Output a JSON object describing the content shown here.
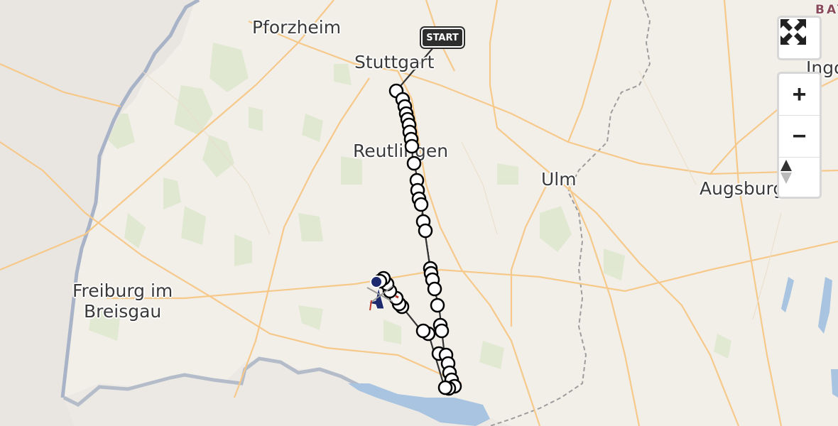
{
  "map": {
    "cities": [
      {
        "id": "pforzheim",
        "label": "Pforzheim"
      },
      {
        "id": "stuttgart",
        "label": "Stuttgart"
      },
      {
        "id": "reutlingen",
        "label": "Reutlingen"
      },
      {
        "id": "ulm",
        "label": "Ulm"
      },
      {
        "id": "augsburg",
        "label": "Augsburg"
      },
      {
        "id": "freiburg",
        "label": "Freiburg im\nBreisgau"
      },
      {
        "id": "ingolstadt",
        "label": "Ingo"
      }
    ],
    "region_label": "BAY",
    "start_marker": "START",
    "route_color": "#333333",
    "marker_fill": "#ffffff",
    "vehicle_icon": "aircraft-icon",
    "water_color": "#a8c4e0"
  },
  "controls": {
    "fullscreen_icon": "fullscreen-icon",
    "zoom_in_label": "+",
    "zoom_out_label": "−",
    "compass_icon": "compass-north-icon"
  }
}
